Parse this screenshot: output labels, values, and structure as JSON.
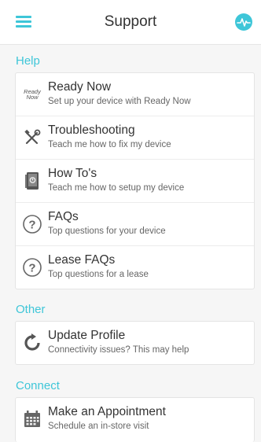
{
  "header": {
    "title": "Support",
    "menu_icon": "hamburger-menu-icon",
    "activity_icon": "activity-pulse-icon",
    "accent_color": "#3ec6d8"
  },
  "sections": {
    "help": {
      "title": "Help",
      "items": [
        {
          "label": "Ready Now",
          "subtitle": "Set up your device with Ready Now",
          "icon": "ready-now-icon",
          "icon_text_top": "Ready",
          "icon_text_bottom": "Now"
        },
        {
          "label": "Troubleshooting",
          "subtitle": "Teach me how to fix my device",
          "icon": "tools-icon"
        },
        {
          "label": "How To's",
          "subtitle": "Teach me how to setup my device",
          "icon": "device-guide-icon"
        },
        {
          "label": "FAQs",
          "subtitle": "Top questions for your device",
          "icon": "question-icon"
        },
        {
          "label": "Lease FAQs",
          "subtitle": "Top questions for a lease",
          "icon": "question-icon"
        }
      ]
    },
    "other": {
      "title": "Other",
      "items": [
        {
          "label": "Update Profile",
          "subtitle": "Connectivity issues? This may help",
          "icon": "refresh-profile-icon"
        }
      ]
    },
    "connect": {
      "title": "Connect",
      "items": [
        {
          "label": "Make an Appointment",
          "subtitle": "Schedule an in-store visit",
          "icon": "calendar-icon"
        }
      ]
    }
  }
}
